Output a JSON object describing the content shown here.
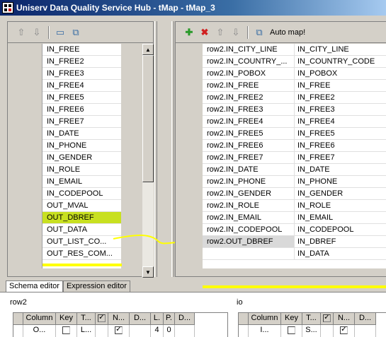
{
  "window": {
    "title": "Uniserv Data Quality Service Hub - tMap - tMap_3"
  },
  "left_toolbar": {
    "icons": [
      "up-arrow-icon",
      "down-arrow-icon",
      "table-view-icon",
      "copy-icon"
    ]
  },
  "right_toolbar": {
    "icons": [
      "add-icon",
      "remove-icon",
      "up-arrow-icon",
      "down-arrow-icon",
      "copy-icon"
    ],
    "auto_map_label": "Auto map!"
  },
  "left_list": {
    "rows": [
      "IN_FREE",
      "IN_FREE2",
      "IN_FREE3",
      "IN_FREE4",
      "IN_FREE5",
      "IN_FREE6",
      "IN_FREE7",
      "IN_DATE",
      "IN_PHONE",
      "IN_GENDER",
      "IN_ROLE",
      "IN_EMAIL",
      "IN_CODEPOOL",
      "OUT_MVAL",
      "OUT_DBREF",
      "OUT_DATA",
      "OUT_LIST_CO...",
      "OUT_RES_COM..."
    ],
    "selected": "OUT_DBREF"
  },
  "right_table": {
    "rows": [
      [
        "row2.IN_CITY_LINE",
        "IN_CITY_LINE"
      ],
      [
        "row2.IN_COUNTRY_...",
        "IN_COUNTRY_CODE"
      ],
      [
        "row2.IN_POBOX",
        "IN_POBOX"
      ],
      [
        "row2.IN_FREE",
        "IN_FREE"
      ],
      [
        "row2.IN_FREE2",
        "IN_FREE2"
      ],
      [
        "row2.IN_FREE3",
        "IN_FREE3"
      ],
      [
        "row2.IN_FREE4",
        "IN_FREE4"
      ],
      [
        "row2.IN_FREE5",
        "IN_FREE5"
      ],
      [
        "row2.IN_FREE6",
        "IN_FREE6"
      ],
      [
        "row2.IN_FREE7",
        "IN_FREE7"
      ],
      [
        "row2.IN_DATE",
        "IN_DATE"
      ],
      [
        "row2.IN_PHONE",
        "IN_PHONE"
      ],
      [
        "row2.IN_GENDER",
        "IN_GENDER"
      ],
      [
        "row2.IN_ROLE",
        "IN_ROLE"
      ],
      [
        "row2.IN_EMAIL",
        "IN_EMAIL"
      ],
      [
        "row2.IN_CODEPOOL",
        "IN_CODEPOOL"
      ],
      [
        "row2.OUT_DBREF",
        "IN_DBREF"
      ],
      [
        "",
        "IN_DATA"
      ]
    ]
  },
  "bottom_tabs": [
    "Schema editor",
    "Expression editor"
  ],
  "schema_left": {
    "title": "row2",
    "headers": [
      "",
      "Column",
      "Key",
      "T...",
      "✓",
      "N...",
      "D...",
      "L.",
      "P.",
      "D..."
    ],
    "row": [
      "",
      "O...",
      "",
      "L...",
      "",
      "",
      "",
      "4",
      "0",
      ""
    ]
  },
  "schema_right": {
    "title": "io",
    "headers": [
      "",
      "Column",
      "Key",
      "T...",
      "✓",
      "N...",
      "D..."
    ],
    "row": [
      "",
      "I...",
      "",
      "S...",
      "",
      "",
      ""
    ]
  },
  "colors": {
    "link_line": "#ffff00",
    "selected_row": "#c8e020",
    "title_bar": "#0a246a"
  }
}
